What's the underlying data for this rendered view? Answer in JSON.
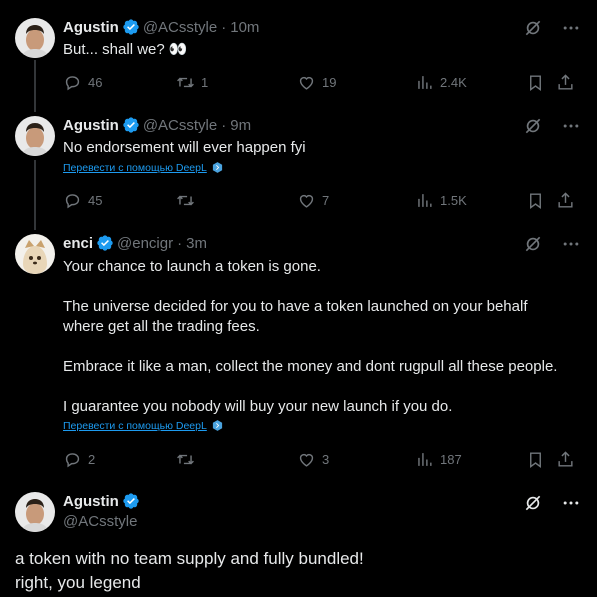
{
  "tweets": [
    {
      "name": "Agustin",
      "handle": "@ACsstyle",
      "time": "10m",
      "text": "But... shall we? 👀",
      "translate": "",
      "replies": "46",
      "retweets": "1",
      "likes": "19",
      "views": "2.4K"
    },
    {
      "name": "Agustin",
      "handle": "@ACsstyle",
      "time": "9m",
      "text": "No endorsement will ever happen fyi",
      "translate": "Перевести с помощью DeepL",
      "replies": "45",
      "retweets": "",
      "likes": "7",
      "views": "1.5K"
    },
    {
      "name": "enci",
      "handle": "@encigr",
      "time": "3m",
      "text": "Your chance to launch a token is gone.\n\nThe universe decided for you to have a token launched on your behalf\nwhere get all the trading fees.\n\nEmbrace it like a man, collect the money and dont rugpull all these people.\n\nI guarantee you nobody will buy your new launch if you do.",
      "translate": "Перевести с помощью DeepL",
      "replies": "2",
      "retweets": "",
      "likes": "3",
      "views": "187"
    }
  ],
  "main_tweet": {
    "name": "Agustin",
    "handle": "@ACsstyle",
    "text": "a token with no team supply and fully bundled!\nright, you legend"
  },
  "colors": {
    "background": "#000000",
    "text": "#e7e9ea",
    "muted": "#71767b",
    "accent": "#1d9bf0"
  },
  "icons": [
    "verified-badge-icon",
    "grok-icon",
    "more-icon",
    "reply-icon",
    "retweet-icon",
    "like-icon",
    "views-icon",
    "bookmark-icon",
    "share-icon",
    "deepl-icon"
  ]
}
